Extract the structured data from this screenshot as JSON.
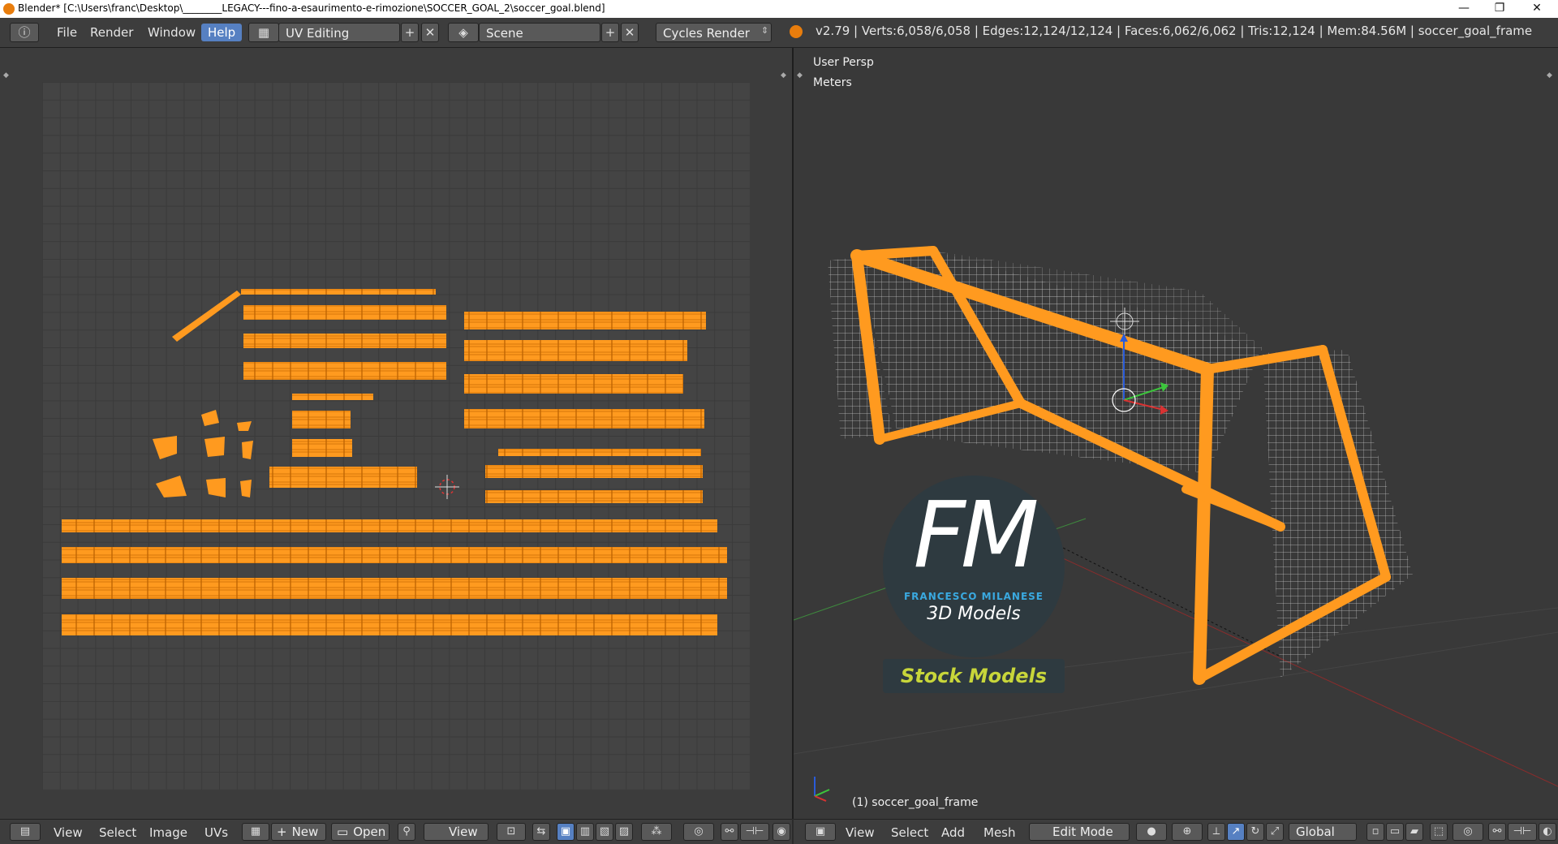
{
  "window": {
    "title": "Blender* [C:\\Users\\franc\\Desktop\\________LEGACY---fino-a-esaurimento-e-rimozione\\SOCCER_GOAL_2\\soccer_goal.blend]",
    "minimize": "—",
    "maximize": "❐",
    "close": "✕"
  },
  "menu": {
    "file": "File",
    "render": "Render",
    "window": "Window",
    "help": "Help"
  },
  "screen_layout": "UV Editing",
  "scene": "Scene",
  "render_engine": "Cycles Render",
  "stats": "v2.79 | Verts:6,058/6,058 | Edges:12,124/12,124 | Faces:6,062/6,062 | Tris:12,124 | Mem:84.56M | soccer_goal_frame",
  "viewport": {
    "view_label": "User Persp",
    "units_label": "Meters",
    "object_label": "(1) soccer_goal_frame"
  },
  "watermark": {
    "logo": "FM",
    "author": "FRANCESCO MILANESE",
    "subtitle": "3D Models",
    "tag": "Stock Models"
  },
  "uv_footer": {
    "view": "View",
    "select": "Select",
    "image": "Image",
    "uvs": "UVs",
    "new": "New",
    "open": "Open",
    "view2": "View"
  },
  "view3d_footer": {
    "view": "View",
    "select": "Select",
    "add": "Add",
    "mesh": "Mesh",
    "mode": "Edit Mode",
    "orientation": "Global"
  },
  "colors": {
    "accent": "#5680c2",
    "selection": "#ff9a1f",
    "header": "#3d3d3d",
    "grid_bg": "#444444",
    "viewport_bg": "#393939"
  },
  "icons": [
    "info-icon",
    "layout-icon",
    "scene-icon",
    "blender-logo-icon",
    "editor-type-icon",
    "cube-icon",
    "pivot-icon",
    "manipulator-icon",
    "cursor-icon"
  ]
}
